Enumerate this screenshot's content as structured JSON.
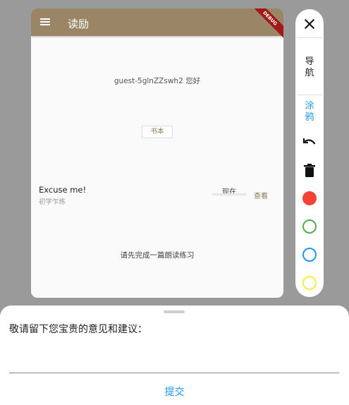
{
  "app_bar": {
    "title": "读励",
    "debug_banner": "DEBUG"
  },
  "home": {
    "greeting": "guest-5glnZZswh2 您好",
    "book_button_label": "书本",
    "lesson_item": {
      "title": "Excuse me!",
      "subtitle": "初学乍练",
      "status_label": "现在",
      "view_label": "查看"
    },
    "notice": "请先完成一篇朗读练习"
  },
  "sidebar": {
    "nav_tab_label": "导航",
    "draw_tab_label": "涂鸦",
    "colors": [
      {
        "name": "red",
        "hex": "#f44336",
        "filled": true
      },
      {
        "name": "green",
        "hex": "#4caf50",
        "filled": false
      },
      {
        "name": "blue",
        "hex": "#2196f3",
        "filled": false
      },
      {
        "name": "yellow",
        "hex": "#ffeb3b",
        "filled": false
      }
    ]
  },
  "feedback_sheet": {
    "prompt": "敬请留下您宝贵的意见和建议：",
    "input_value": "",
    "submit_label": "提交"
  }
}
